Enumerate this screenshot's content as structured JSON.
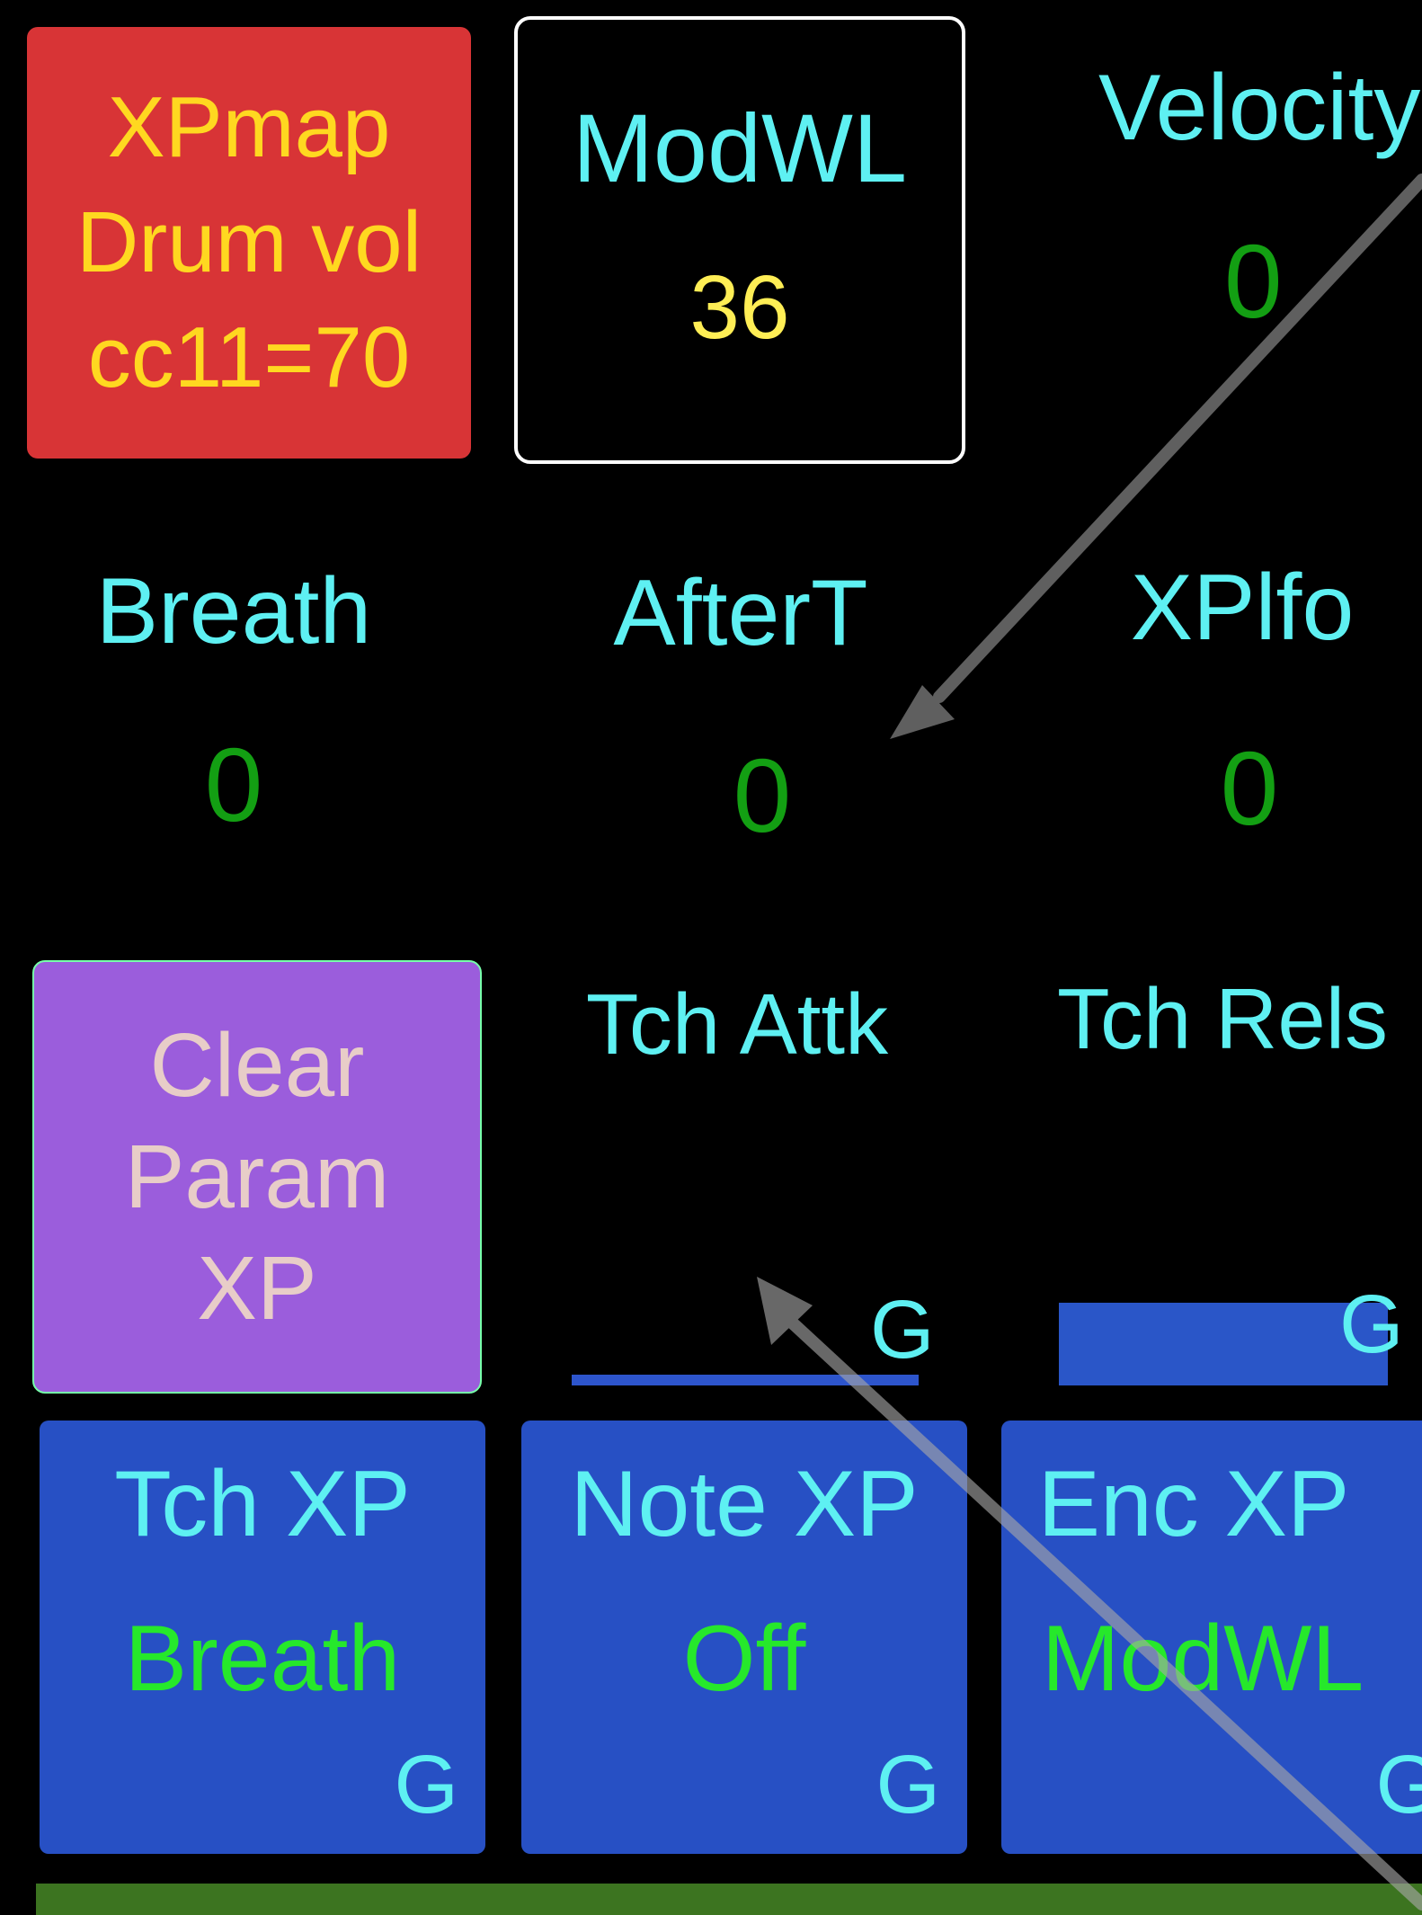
{
  "top": {
    "xpmap_button": {
      "line1": "XPmap",
      "line2": "Drum vol",
      "line3": "cc11=70",
      "color": "#d83436"
    },
    "modwl": {
      "title": "ModWL",
      "value": "36"
    },
    "velocity": {
      "title": "Velocity",
      "value": "0"
    }
  },
  "middle": {
    "breath": {
      "title": "Breath",
      "value": "0"
    },
    "aftert": {
      "title": "AfterT",
      "value": "0"
    },
    "xplfo": {
      "title": "XPlfo",
      "value": "0"
    }
  },
  "lower": {
    "clear_button": {
      "line1": "Clear",
      "line2": "Param",
      "line3": "XP",
      "color": "#9b5ddc"
    },
    "tch_attk": {
      "title": "Tch Attk",
      "g": "G"
    },
    "tch_rels": {
      "title": "Tch Rels",
      "g": "G"
    }
  },
  "buttons": [
    {
      "title": "Tch XP",
      "value": "Breath",
      "g": "G"
    },
    {
      "title": "Note XP",
      "value": "Off",
      "g": "G"
    },
    {
      "title": "Enc XP",
      "value": "ModWL",
      "g": "G"
    }
  ],
  "colors": {
    "accent_cyan": "#5ef0f2",
    "value_green": "#139f13",
    "button_blue": "#2750c4"
  }
}
